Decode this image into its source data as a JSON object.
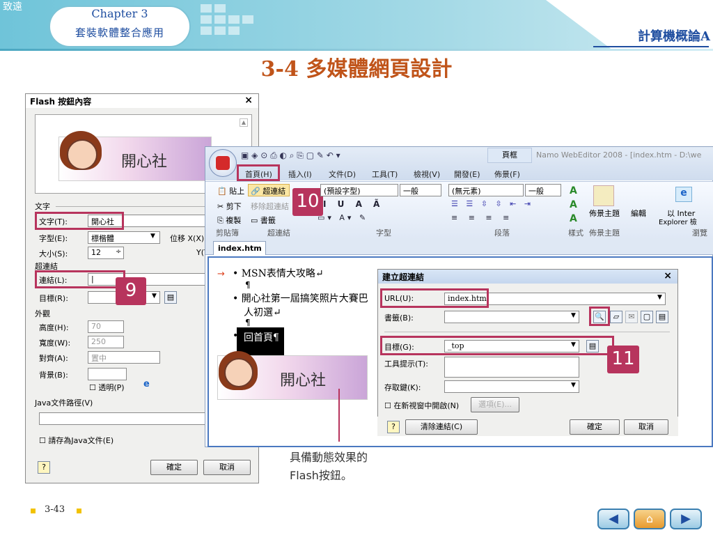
{
  "header": {
    "logo": "致遠",
    "chapter": "Chapter 3",
    "chapter_title": "套裝軟體整合應用",
    "course": "計算機概論A"
  },
  "slide_title": "3-4 多媒體網頁設計",
  "flash_dialog": {
    "title": "Flash 按鈕內容",
    "close": "×",
    "preview_text": "開心社",
    "section_text": "文字",
    "text_label": "文字(T):",
    "text_value": "開心社",
    "font_label": "字型(E):",
    "font_value": "標楷體",
    "offset_label": "位移 X(X):",
    "size_label": "大小(S):",
    "size_value": "12",
    "y_label": "Y(Y):",
    "section_link": "超連結",
    "link_label": "連結(L):",
    "link_value": "|",
    "target_label": "目標(R):",
    "section_appearance": "外觀",
    "height_label": "高度(H):",
    "height_value": "70",
    "width_label": "寬度(W):",
    "width_value": "250",
    "align_label": "對齊(A):",
    "align_value": "置中",
    "bg_label": "背景(B):",
    "transparent_label": "透明(P)",
    "java_path_label": "Java文件路徑(V)",
    "save_java_label": "請存為Java文件(E)",
    "ok": "確定",
    "cancel": "取消"
  },
  "namo": {
    "window_title": "Namo WebEditor 2008 - [index.htm - D:\\we",
    "context_tab": "頁框",
    "tabs": [
      "首頁(H)",
      "插入(I)",
      "文件(D)",
      "工具(T)",
      "檢視(V)",
      "開發(E)",
      "佈景(F)"
    ],
    "clipboard": {
      "paste": "貼上",
      "cut": "剪下",
      "copy": "複製",
      "group": "剪貼簿"
    },
    "link": {
      "hyperlink": "超連結",
      "remove": "移除超連結",
      "bookmark": "書籤",
      "group": "超連結"
    },
    "font": {
      "face": "(預設字型)",
      "size": "一般",
      "group": "字型"
    },
    "paragraph": {
      "style": "(無元素)",
      "size": "一般",
      "group": "段落"
    },
    "theme": {
      "label": "佈景主題",
      "group": "佈景主題",
      "style_group": "樣式"
    },
    "edit_label": "編輯",
    "browse": {
      "label1": "以 Inter",
      "label2": "Explorer 檢",
      "group": "瀏覽"
    },
    "doc_tab": "index.htm",
    "bullets": [
      "MSN表情大攻略↵",
      "開心社第一屆搞笑照片大賽巴",
      "人初選↵",
      "回首頁¶"
    ],
    "pilcrow": "¶",
    "arrow": "→"
  },
  "link_dialog": {
    "title": "建立超連結",
    "close": "×",
    "url_label": "URL(U):",
    "url_value": "index.htm",
    "bookmark_label": "書籤(B):",
    "target_label": "目標(G):",
    "target_value": "_top",
    "tooltip_label": "工具提示(T):",
    "accesskey_label": "存取鍵(K):",
    "newwin_label": "在新視窗中開啟(N)",
    "options_btn": "選項(E)...",
    "clear_btn": "清除連結(C)",
    "ok": "確定",
    "cancel": "取消"
  },
  "callouts": {
    "c9": "9",
    "c10": "10",
    "c11": "11"
  },
  "caption": [
    "具備動態效果的",
    "Flash按鈕。"
  ],
  "footer": {
    "page": "3-43"
  },
  "colors": {
    "accent": "#b7345d",
    "title": "#c0541a",
    "blue": "#1f4ea0"
  }
}
